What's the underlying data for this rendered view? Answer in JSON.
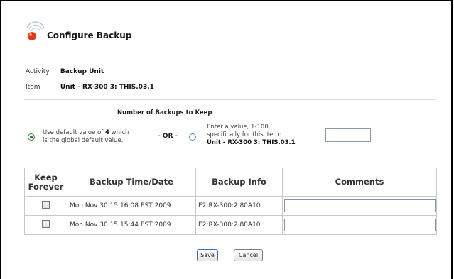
{
  "header": {
    "title": "Configure Backup"
  },
  "details": {
    "activity_label": "Activity",
    "activity_value": "Backup Unit",
    "item_label": "Item",
    "item_value": "Unit - RX-300 3: THIS.03.1"
  },
  "backups": {
    "title": "Number of Backups to Keep",
    "default_option": {
      "selected": true,
      "line1_prefix": "Use default value of ",
      "default_value": "4",
      "line1_suffix": " which",
      "line2": "is the global default value."
    },
    "or_label": "- OR -",
    "custom_option": {
      "selected": false,
      "line1": "Enter a value, 1-100,",
      "line2": "specifically for this item:",
      "line3": "Unit - RX-300 3: THIS.03.1",
      "value": ""
    }
  },
  "table": {
    "headers": {
      "keep_line1": "Keep",
      "keep_line2": "Forever",
      "time": "Backup Time/Date",
      "info": "Backup Info",
      "comments": "Comments"
    },
    "rows": [
      {
        "keep": false,
        "time": "Mon Nov 30 15:16:08 EST 2009",
        "info": "E2:RX-300:2.80A10",
        "comment": ""
      },
      {
        "keep": false,
        "time": "Mon Nov 30 15:15:44 EST 2009",
        "info": "E2:RX-300:2.80A10",
        "comment": ""
      }
    ]
  },
  "buttons": {
    "save": "Save",
    "cancel": "Cancel"
  },
  "colors": {
    "radio_selected": "#2e7d2e",
    "logo_dot": "#e0391a",
    "button_border": "#3a6fb0"
  }
}
